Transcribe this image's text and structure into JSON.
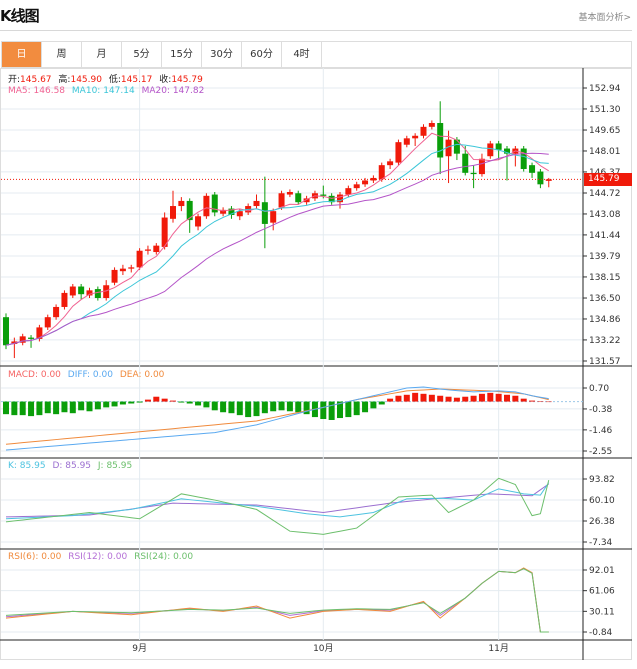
{
  "header": {
    "title": "K线图",
    "link": "基本面分析>"
  },
  "tabs": [
    {
      "label": "日",
      "active": true
    },
    {
      "label": "周"
    },
    {
      "label": "月"
    },
    {
      "label": "5分"
    },
    {
      "label": "15分"
    },
    {
      "label": "30分"
    },
    {
      "label": "60分"
    },
    {
      "label": "4时"
    }
  ],
  "ohlc_legend": {
    "open_label": "开:",
    "open": "145.67",
    "high_label": "高:",
    "high": "145.90",
    "low_label": "低:",
    "low": "145.17",
    "close_label": "收:",
    "close": "145.79"
  },
  "ma_legend": {
    "ma5": "MA5: 146.58",
    "ma10": "MA10: 147.14",
    "ma20": "MA20: 147.82"
  },
  "macd_legend": {
    "macd": "MACD: 0.00",
    "diff": "DIFF: 0.00",
    "dea": "DEA: 0.00"
  },
  "kdj_legend": {
    "k": "K: 85.95",
    "d": "D: 85.95",
    "j": "J: 85.95"
  },
  "rsi_legend": {
    "rsi6": "RSI(6): 0.00",
    "rsi12": "RSI(12): 0.00",
    "rsi24": "RSI(24): 0.00"
  },
  "current_price": "145.79",
  "colors": {
    "up": "#f01a0a",
    "down": "#0a9e0a",
    "ma5": "#f06292",
    "ma10": "#3cc6d8",
    "ma20": "#b455c8",
    "diff": "#5aa9f0",
    "dea": "#f08a3c",
    "k": "#4ec3e0",
    "d": "#9b6fd0",
    "j": "#6cbf6c",
    "rsi6": "#f08a3c",
    "rsi12": "#b46fd6",
    "rsi24": "#6cbf6c",
    "accent": "#f28c3f"
  },
  "chart_data": {
    "type": "candlestick",
    "x_labels": [
      {
        "index": 16,
        "label": "9月"
      },
      {
        "index": 38,
        "label": "10月"
      },
      {
        "index": 59,
        "label": "11月"
      }
    ],
    "price_axis": {
      "ticks": [
        "152.94",
        "151.30",
        "149.65",
        "148.01",
        "146.37",
        "144.72",
        "143.08",
        "141.44",
        "139.79",
        "138.15",
        "136.50",
        "134.86",
        "133.22",
        "131.57"
      ],
      "range": [
        131.57,
        152.94
      ]
    },
    "macd_axis": {
      "ticks": [
        "0.70",
        "-0.38",
        "-1.46",
        "-2.55"
      ],
      "range": [
        -2.55,
        0.7
      ]
    },
    "kdj_axis": {
      "ticks": [
        "93.82",
        "60.10",
        "26.38",
        "-7.34"
      ],
      "range": [
        -7.34,
        93.82
      ]
    },
    "rsi_axis": {
      "ticks": [
        "92.01",
        "61.06",
        "30.11",
        "-0.84"
      ],
      "range": [
        -0.84,
        92.01
      ]
    },
    "candles": [
      [
        135.0,
        135.3,
        132.5,
        132.8
      ],
      [
        132.9,
        133.4,
        131.8,
        133.1
      ],
      [
        133.0,
        133.7,
        132.8,
        133.5
      ],
      [
        133.4,
        133.6,
        132.6,
        133.3
      ],
      [
        133.3,
        134.4,
        133.1,
        134.2
      ],
      [
        134.2,
        135.2,
        134.0,
        135.0
      ],
      [
        135.0,
        136.0,
        134.8,
        135.8
      ],
      [
        135.8,
        137.1,
        135.6,
        136.9
      ],
      [
        136.7,
        137.6,
        136.5,
        137.4
      ],
      [
        137.4,
        137.6,
        136.4,
        136.8
      ],
      [
        136.7,
        137.3,
        136.5,
        137.1
      ],
      [
        137.2,
        137.4,
        136.3,
        136.5
      ],
      [
        136.5,
        137.9,
        136.3,
        137.5
      ],
      [
        137.7,
        138.9,
        137.5,
        138.7
      ],
      [
        138.6,
        139.1,
        138.3,
        138.8
      ],
      [
        138.8,
        139.1,
        138.5,
        138.9
      ],
      [
        138.9,
        140.4,
        138.7,
        140.2
      ],
      [
        140.2,
        140.6,
        139.9,
        140.3
      ],
      [
        140.1,
        140.8,
        139.9,
        140.6
      ],
      [
        140.5,
        143.2,
        140.3,
        142.8
      ],
      [
        142.7,
        144.9,
        142.4,
        143.7
      ],
      [
        143.7,
        144.4,
        143.3,
        144.1
      ],
      [
        144.1,
        144.3,
        141.6,
        142.6
      ],
      [
        142.1,
        143.1,
        141.8,
        142.9
      ],
      [
        142.9,
        144.7,
        142.7,
        144.5
      ],
      [
        144.6,
        144.8,
        142.9,
        143.2
      ],
      [
        143.1,
        143.6,
        142.9,
        143.4
      ],
      [
        143.5,
        143.7,
        142.7,
        143.0
      ],
      [
        142.9,
        143.5,
        142.6,
        143.3
      ],
      [
        143.2,
        143.9,
        143.0,
        143.7
      ],
      [
        143.7,
        144.6,
        143.5,
        144.1
      ],
      [
        144.0,
        146.0,
        140.4,
        142.3
      ],
      [
        142.4,
        143.5,
        141.8,
        143.3
      ],
      [
        143.6,
        144.9,
        143.4,
        144.7
      ],
      [
        144.6,
        145.0,
        144.4,
        144.8
      ],
      [
        144.7,
        144.9,
        143.8,
        144.0
      ],
      [
        144.0,
        144.5,
        143.8,
        144.3
      ],
      [
        144.3,
        144.9,
        144.1,
        144.7
      ],
      [
        144.6,
        145.3,
        144.3,
        144.5
      ],
      [
        144.5,
        144.7,
        143.8,
        144.0
      ],
      [
        144.0,
        144.8,
        143.5,
        144.6
      ],
      [
        144.6,
        145.3,
        144.4,
        145.1
      ],
      [
        145.1,
        145.6,
        144.9,
        145.4
      ],
      [
        145.4,
        145.9,
        145.2,
        145.7
      ],
      [
        145.7,
        146.1,
        145.5,
        145.9
      ],
      [
        145.8,
        147.1,
        145.6,
        146.9
      ],
      [
        146.9,
        147.4,
        146.6,
        147.2
      ],
      [
        147.1,
        148.9,
        146.9,
        148.7
      ],
      [
        148.5,
        149.2,
        148.3,
        149.0
      ],
      [
        149.0,
        149.4,
        148.4,
        149.2
      ],
      [
        149.2,
        150.1,
        149.0,
        149.9
      ],
      [
        149.9,
        150.4,
        149.7,
        150.2
      ],
      [
        150.2,
        151.9,
        146.2,
        147.5
      ],
      [
        147.6,
        149.6,
        145.5,
        148.9
      ],
      [
        148.9,
        149.1,
        147.3,
        147.8
      ],
      [
        147.8,
        148.4,
        146.1,
        146.3
      ],
      [
        146.3,
        146.9,
        145.1,
        146.2
      ],
      [
        146.2,
        147.8,
        146.0,
        147.4
      ],
      [
        147.6,
        148.8,
        147.4,
        148.6
      ],
      [
        148.6,
        148.8,
        147.3,
        148.1
      ],
      [
        148.2,
        148.4,
        145.7,
        147.8
      ],
      [
        147.8,
        148.4,
        146.8,
        148.2
      ],
      [
        148.2,
        148.4,
        146.4,
        146.6
      ],
      [
        146.9,
        147.1,
        145.9,
        146.3
      ],
      [
        146.4,
        146.6,
        145.1,
        145.4
      ],
      [
        145.67,
        145.9,
        145.17,
        145.79
      ]
    ],
    "macd_hist": [
      -0.65,
      -0.7,
      -0.7,
      -0.75,
      -0.7,
      -0.6,
      -0.65,
      -0.55,
      -0.6,
      -0.45,
      -0.5,
      -0.4,
      -0.3,
      -0.25,
      -0.15,
      -0.1,
      -0.05,
      0.1,
      0.25,
      0.15,
      0.05,
      -0.05,
      -0.1,
      -0.2,
      -0.3,
      -0.45,
      -0.55,
      -0.6,
      -0.7,
      -0.8,
      -0.75,
      -0.6,
      -0.5,
      -0.45,
      -0.5,
      -0.55,
      -0.65,
      -0.8,
      -0.9,
      -0.95,
      -0.85,
      -0.8,
      -0.7,
      -0.55,
      -0.35,
      -0.15,
      0.15,
      0.3,
      0.35,
      0.45,
      0.4,
      0.35,
      0.3,
      0.25,
      0.2,
      0.25,
      0.3,
      0.4,
      0.45,
      0.4,
      0.35,
      0.3,
      0.15,
      0.05,
      0.02,
      0.0
    ],
    "diff_knots": [
      [
        0,
        -2.5
      ],
      [
        25,
        -1.6
      ],
      [
        30,
        -1.2
      ],
      [
        36,
        -0.5
      ],
      [
        40,
        -0.1
      ],
      [
        44,
        0.3
      ],
      [
        48,
        0.7
      ],
      [
        50,
        0.75
      ],
      [
        53,
        0.6
      ],
      [
        56,
        0.5
      ],
      [
        59,
        0.55
      ],
      [
        61,
        0.5
      ],
      [
        63,
        0.3
      ],
      [
        65,
        0.15
      ]
    ],
    "dea_knots": [
      [
        0,
        -2.2
      ],
      [
        30,
        -1.0
      ],
      [
        38,
        -0.3
      ],
      [
        42,
        0.1
      ],
      [
        48,
        0.55
      ],
      [
        52,
        0.65
      ],
      [
        58,
        0.55
      ],
      [
        62,
        0.4
      ],
      [
        65,
        0.1
      ]
    ],
    "k_knots": [
      [
        0,
        30
      ],
      [
        8,
        35
      ],
      [
        15,
        45
      ],
      [
        21,
        62
      ],
      [
        26,
        55
      ],
      [
        30,
        50
      ],
      [
        36,
        38
      ],
      [
        40,
        33
      ],
      [
        44,
        40
      ],
      [
        48,
        62
      ],
      [
        52,
        63
      ],
      [
        56,
        60
      ],
      [
        59,
        78
      ],
      [
        62,
        70
      ],
      [
        64,
        68
      ],
      [
        65,
        88
      ]
    ],
    "d_knots": [
      [
        0,
        33
      ],
      [
        10,
        36
      ],
      [
        20,
        55
      ],
      [
        30,
        52
      ],
      [
        38,
        40
      ],
      [
        46,
        55
      ],
      [
        52,
        63
      ],
      [
        58,
        70
      ],
      [
        63,
        67
      ],
      [
        65,
        86
      ]
    ],
    "j_knots": [
      [
        0,
        25
      ],
      [
        10,
        40
      ],
      [
        16,
        30
      ],
      [
        21,
        70
      ],
      [
        25,
        60
      ],
      [
        30,
        45
      ],
      [
        34,
        10
      ],
      [
        38,
        5
      ],
      [
        42,
        15
      ],
      [
        47,
        65
      ],
      [
        51,
        68
      ],
      [
        53,
        40
      ],
      [
        56,
        60
      ],
      [
        59,
        95
      ],
      [
        61,
        85
      ],
      [
        63,
        35
      ],
      [
        64,
        38
      ],
      [
        65,
        92
      ]
    ],
    "rsi6_knots": [
      [
        0,
        20
      ],
      [
        8,
        30
      ],
      [
        15,
        25
      ],
      [
        22,
        35
      ],
      [
        26,
        30
      ],
      [
        30,
        38
      ],
      [
        34,
        20
      ],
      [
        38,
        30
      ],
      [
        42,
        33
      ],
      [
        46,
        30
      ],
      [
        50,
        45
      ],
      [
        52,
        20
      ],
      [
        55,
        50
      ],
      [
        57,
        72
      ],
      [
        59,
        90
      ],
      [
        61,
        88
      ],
      [
        62,
        95
      ],
      [
        63,
        88
      ],
      [
        64,
        -0.84
      ],
      [
        65,
        -0.84
      ]
    ],
    "rsi12_knots": [
      [
        0,
        22
      ],
      [
        8,
        30
      ],
      [
        15,
        27
      ],
      [
        22,
        34
      ],
      [
        26,
        31
      ],
      [
        30,
        36
      ],
      [
        34,
        24
      ],
      [
        38,
        31
      ],
      [
        42,
        33
      ],
      [
        46,
        32
      ],
      [
        50,
        44
      ],
      [
        52,
        24
      ],
      [
        55,
        50
      ],
      [
        57,
        72
      ],
      [
        59,
        90
      ],
      [
        61,
        88
      ],
      [
        62,
        94
      ],
      [
        63,
        88
      ],
      [
        64,
        -0.84
      ],
      [
        65,
        -0.84
      ]
    ],
    "rsi24_knots": [
      [
        0,
        24
      ],
      [
        8,
        30
      ],
      [
        15,
        28
      ],
      [
        22,
        33
      ],
      [
        26,
        32
      ],
      [
        30,
        35
      ],
      [
        34,
        27
      ],
      [
        38,
        32
      ],
      [
        42,
        34
      ],
      [
        46,
        33
      ],
      [
        50,
        43
      ],
      [
        52,
        27
      ],
      [
        55,
        50
      ],
      [
        57,
        72
      ],
      [
        59,
        90
      ],
      [
        61,
        88
      ],
      [
        62,
        94
      ],
      [
        63,
        87
      ],
      [
        64,
        -0.84
      ],
      [
        65,
        -0.84
      ]
    ]
  }
}
